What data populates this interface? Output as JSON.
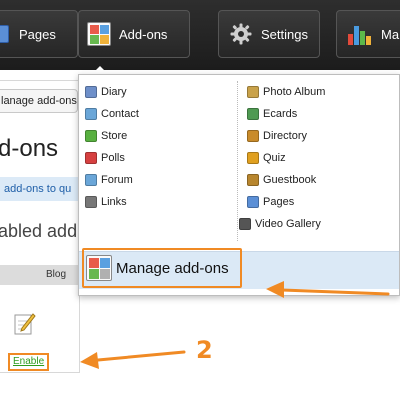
{
  "nav": {
    "pages_label": "Pages",
    "addons_label": "Add-ons",
    "settings_label": "Settings",
    "marketing_label_partial": "Ma"
  },
  "left_panel": {
    "tab_label": "lanage add-ons",
    "title": "d-ons",
    "hint": "add-ons to qu",
    "subtitle": "abled add",
    "blog_label": "Blog",
    "enable_label": "Enable"
  },
  "dropdown": {
    "left_items": [
      {
        "label": "Diary",
        "icon": "diary-icon",
        "color": "#6e8fc9"
      },
      {
        "label": "Contact",
        "icon": "contact-icon",
        "color": "#6aa6d8"
      },
      {
        "label": "Store",
        "icon": "store-icon",
        "color": "#58b040"
      },
      {
        "label": "Polls",
        "icon": "polls-icon",
        "color": "#d64040"
      },
      {
        "label": "Forum",
        "icon": "forum-icon",
        "color": "#6aa6d8"
      },
      {
        "label": "Links",
        "icon": "links-icon",
        "color": "#777777"
      }
    ],
    "right_items": [
      {
        "label": "Photo Album",
        "icon": "photo-album-icon",
        "color": "#c9a24a"
      },
      {
        "label": "Ecards",
        "icon": "ecards-icon",
        "color": "#4f9a52"
      },
      {
        "label": "Directory",
        "icon": "directory-icon",
        "color": "#c98b2a"
      },
      {
        "label": "Quiz",
        "icon": "quiz-icon",
        "color": "#e0a020"
      },
      {
        "label": "Guestbook",
        "icon": "guestbook-icon",
        "color": "#b8862e"
      },
      {
        "label": "Pages",
        "icon": "pages-icon",
        "color": "#5b8fd6"
      },
      {
        "label": "Video Gallery",
        "icon": "video-gallery-icon",
        "color": "#555555"
      }
    ],
    "manage_label": "Manage add-ons"
  },
  "annotation": {
    "step_number": "2",
    "accent_color": "#f08a24"
  }
}
